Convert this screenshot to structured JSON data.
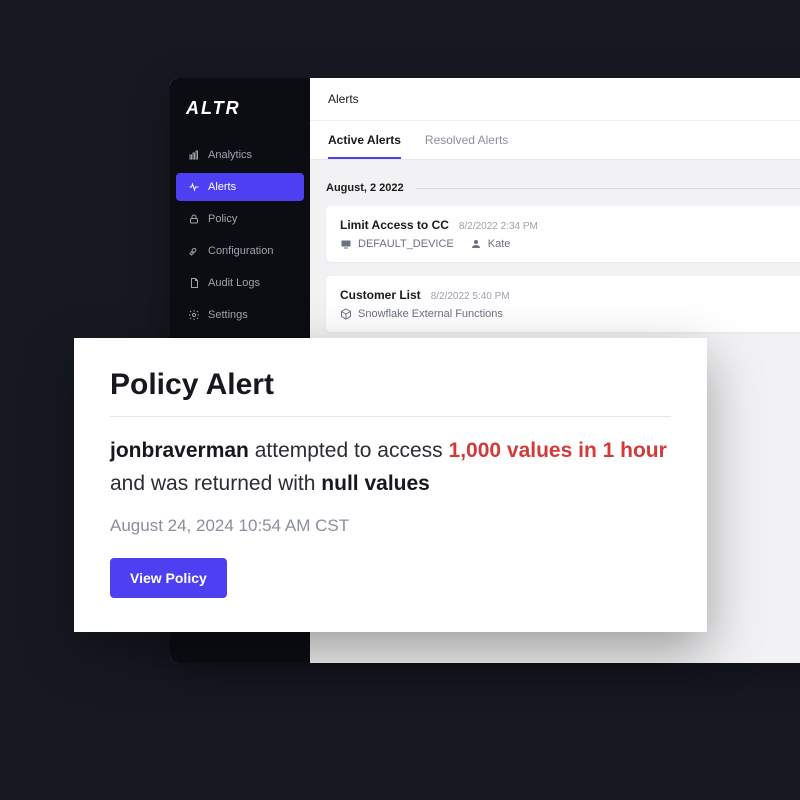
{
  "brand": {
    "logo_text": "ALTR"
  },
  "sidebar": {
    "items": [
      {
        "label": "Analytics",
        "icon": "chart"
      },
      {
        "label": "Alerts",
        "icon": "pulse",
        "active": true
      },
      {
        "label": "Policy",
        "icon": "lock"
      },
      {
        "label": "Configuration",
        "icon": "wrench"
      },
      {
        "label": "Audit Logs",
        "icon": "doc"
      },
      {
        "label": "Settings",
        "icon": "gear"
      }
    ]
  },
  "header": {
    "breadcrumb": "Alerts"
  },
  "tabs": [
    {
      "label": "Active Alerts",
      "active": true
    },
    {
      "label": "Resolved Alerts"
    }
  ],
  "date_group_label": "August, 2 2022",
  "alerts": [
    {
      "title": "Limit Access to CC",
      "timestamp": "8/2/2022 2:34 PM",
      "meta": [
        {
          "icon": "device",
          "text": "DEFAULT_DEVICE"
        },
        {
          "icon": "user",
          "text": "Kate"
        }
      ]
    },
    {
      "title": "Customer List",
      "timestamp": "8/2/2022 5:40 PM",
      "meta": [
        {
          "icon": "cube",
          "text": "Snowflake External Functions"
        }
      ]
    }
  ],
  "policy_alert": {
    "heading": "Policy Alert",
    "username": "jonbraverman",
    "text_before_highlight": "attempted to access",
    "highlight": "1,000 values in 1 hour",
    "text_after_highlight": "and was returned with",
    "bold_tail": "null values",
    "timestamp": "August 24, 2024 10:54 AM CST",
    "button": "View Policy"
  },
  "colors": {
    "accent": "#4d3ff2",
    "danger": "#d43a3a"
  }
}
